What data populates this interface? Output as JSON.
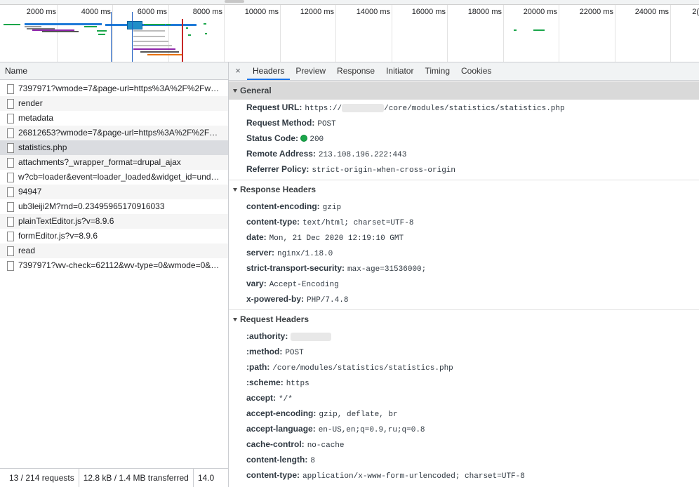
{
  "timeline": {
    "ticks": [
      "2000 ms",
      "4000 ms",
      "6000 ms",
      "8000 ms",
      "10000 ms",
      "12000 ms",
      "14000 ms",
      "16000 ms",
      "18000 ms",
      "20000 ms",
      "22000 ms",
      "24000 ms",
      "2("
    ]
  },
  "list": {
    "header": "Name",
    "rows": [
      "7397971?wmode=7&page-url=https%3A%2F%2Fw…",
      "render",
      "metadata",
      "26812653?wmode=7&page-url=https%3A%2F%2F…",
      "statistics.php",
      "attachments?_wrapper_format=drupal_ajax",
      "w?cb=loader&event=loader_loaded&widget_id=und…",
      "94947",
      "ub3leiji2M?rnd=0.23495965170916033",
      "plainTextEditor.js?v=8.9.6",
      "formEditor.js?v=8.9.6",
      "read",
      "7397971?wv-check=62112&wv-type=0&wmode=0&…"
    ],
    "selected_index": 4,
    "status": {
      "requests": "13 / 214 requests",
      "transferred": "12.8 kB / 1.4 MB transferred",
      "resources": "14.0"
    }
  },
  "tabs": {
    "close": "×",
    "items": [
      "Headers",
      "Preview",
      "Response",
      "Initiator",
      "Timing",
      "Cookies"
    ],
    "active": "Headers"
  },
  "general": {
    "title": "General",
    "request_url_key": "Request URL:",
    "request_url_prefix": "https://",
    "request_url_suffix": "/core/modules/statistics/statistics.php",
    "request_method_key": "Request Method:",
    "request_method": "POST",
    "status_code_key": "Status Code:",
    "status_code": "200",
    "remote_address_key": "Remote Address:",
    "remote_address": "213.108.196.222:443",
    "referrer_policy_key": "Referrer Policy:",
    "referrer_policy": "strict-origin-when-cross-origin"
  },
  "response_headers": {
    "title": "Response Headers",
    "items": [
      {
        "k": "content-encoding:",
        "v": "gzip"
      },
      {
        "k": "content-type:",
        "v": "text/html; charset=UTF-8"
      },
      {
        "k": "date:",
        "v": "Mon, 21 Dec 2020 12:19:10 GMT"
      },
      {
        "k": "server:",
        "v": "nginx/1.18.0"
      },
      {
        "k": "strict-transport-security:",
        "v": "max-age=31536000;"
      },
      {
        "k": "vary:",
        "v": "Accept-Encoding"
      },
      {
        "k": "x-powered-by:",
        "v": "PHP/7.4.8"
      }
    ]
  },
  "request_headers": {
    "title": "Request Headers",
    "authority_key": ":authority:",
    "items": [
      {
        "k": ":method:",
        "v": "POST"
      },
      {
        "k": ":path:",
        "v": "/core/modules/statistics/statistics.php"
      },
      {
        "k": ":scheme:",
        "v": "https"
      },
      {
        "k": "accept:",
        "v": "*/*"
      },
      {
        "k": "accept-encoding:",
        "v": "gzip, deflate, br"
      },
      {
        "k": "accept-language:",
        "v": "en-US,en;q=0.9,ru;q=0.8"
      },
      {
        "k": "cache-control:",
        "v": "no-cache"
      },
      {
        "k": "content-length:",
        "v": "8"
      },
      {
        "k": "content-type:",
        "v": "application/x-www-form-urlencoded; charset=UTF-8"
      }
    ]
  },
  "colors": {
    "accent": "#1a73e8",
    "status_ok": "#1aa64a",
    "selected_row": "#dadce0"
  }
}
